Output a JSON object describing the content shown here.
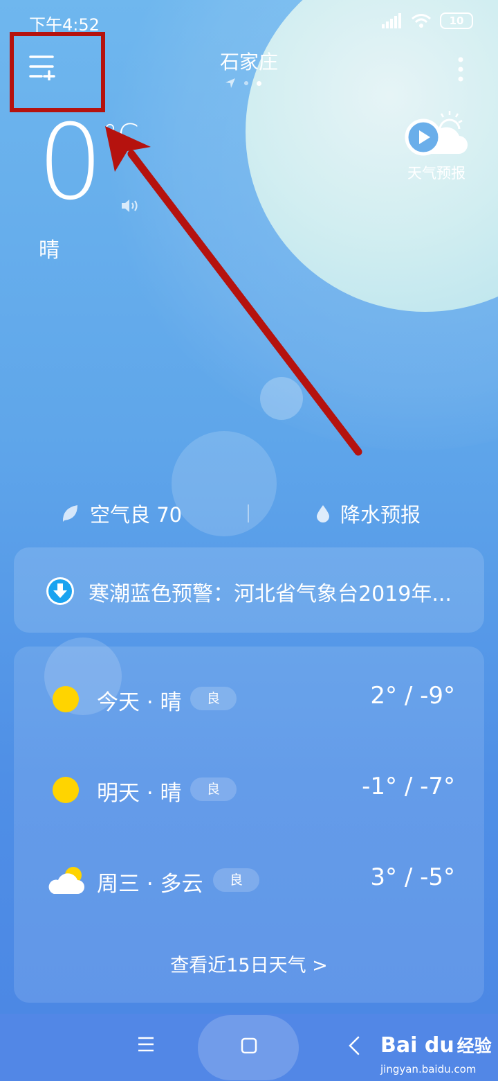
{
  "status_bar": {
    "time": "下午4:52",
    "battery": "10"
  },
  "header": {
    "city": "石家庄"
  },
  "current": {
    "temperature": "0",
    "unit": "°C",
    "condition": "晴"
  },
  "forecast_button": {
    "label": "天气预报"
  },
  "air": {
    "label": "空气良 70"
  },
  "precip": {
    "label": "降水预报"
  },
  "alert": {
    "text": "寒潮蓝色预警：河北省气象台2019年..."
  },
  "days": [
    {
      "label": "今天 · 晴",
      "aqi": "良",
      "temp": "2° / -9°",
      "icon": "sun-icon"
    },
    {
      "label": "明天 · 晴",
      "aqi": "良",
      "temp": "-1° / -7°",
      "icon": "sun-icon"
    },
    {
      "label": "周三 · 多云",
      "aqi": "良",
      "temp": "3° / -5°",
      "icon": "partly-cloudy-icon"
    }
  ],
  "more_days": "查看近15日天气  >",
  "watermark": {
    "logo": "Bai  du",
    "text": "经验",
    "url": "jingyan.baidu.com"
  },
  "colors": {
    "annotation_red": "#b5120e",
    "sun_yellow": "#ffd400",
    "alert_blue": "#1aa3f0"
  }
}
